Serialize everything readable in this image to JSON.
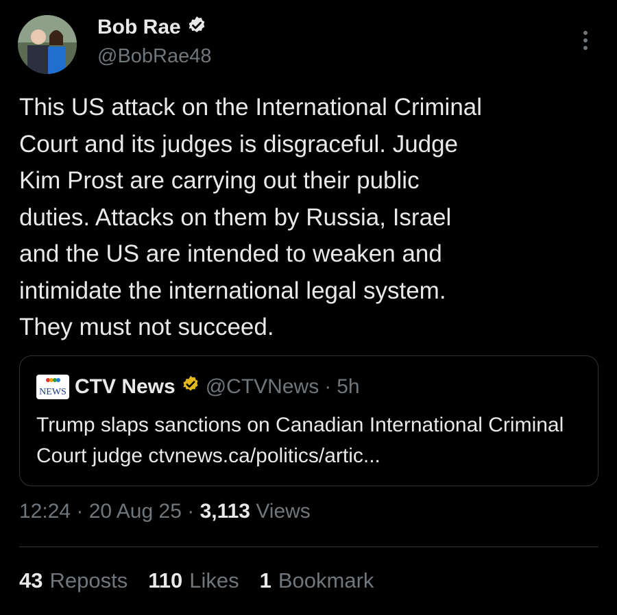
{
  "author": {
    "name": "Bob Rae",
    "handle": "@BobRae48",
    "verified": true
  },
  "tweet": {
    "text": "This US attack on the International Criminal\nCourt and its judges is disgraceful.  Judge\nKim Prost are carrying out their public\nduties.  Attacks on them by Russia, Israel\nand the US are intended to weaken and\nintimidate the international legal system.\nThey must not succeed.",
    "time": "12:24",
    "date": "20 Aug 25",
    "views_count": "3,113",
    "views_label": "Views"
  },
  "quote": {
    "logo_text": "NEWS",
    "name": "CTV News",
    "handle": "@CTVNews",
    "age": "5h",
    "text": "Trump slaps sanctions on Canadian International Criminal Court judge ctvnews.ca/politics/artic..."
  },
  "stats": [
    {
      "count": "43",
      "label": "Reposts"
    },
    {
      "count": "110",
      "label": "Likes"
    },
    {
      "count": "1",
      "label": "Bookmark"
    }
  ],
  "colors": {
    "background": "#000000",
    "text": "#e7e9ea",
    "muted": "#71767b",
    "verified_blue": "#1d9bf0",
    "verified_gold": "#e2b719",
    "border": "#2f3336"
  },
  "icons": {
    "verified": "verified-badge-icon",
    "more": "more-vertical-icon"
  }
}
